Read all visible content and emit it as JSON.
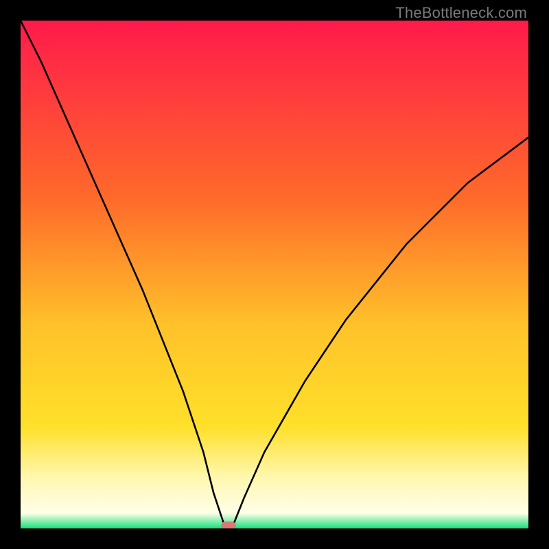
{
  "watermark": "TheBottleneck.com",
  "colors": {
    "red_top": "#ff1a4b",
    "orange": "#ff8a2a",
    "yellow": "#ffe02a",
    "pale_yellow": "#fff7b0",
    "green": "#17e07d",
    "black": "#000000",
    "marker": "#d87a77"
  },
  "chart_data": {
    "type": "line",
    "title": "",
    "xlabel": "",
    "ylabel": "",
    "xlim": [
      0,
      100
    ],
    "ylim": [
      0,
      100
    ],
    "x": [
      0,
      4,
      8,
      12,
      16,
      20,
      24,
      28,
      32,
      36,
      38,
      40,
      41,
      42,
      44,
      48,
      52,
      56,
      60,
      64,
      68,
      72,
      76,
      80,
      84,
      88,
      92,
      96,
      100
    ],
    "values": [
      100,
      92,
      83,
      74,
      65,
      56,
      47,
      37,
      27,
      15,
      7,
      1,
      0,
      1,
      6,
      15,
      22,
      29,
      35,
      41,
      46,
      51,
      56,
      60,
      64,
      68,
      71,
      74,
      77
    ],
    "min_point": {
      "x": 41,
      "y": 0
    },
    "gradient_stops_pct": [
      {
        "offset": 0,
        "color": "#ff1a4b"
      },
      {
        "offset": 35,
        "color": "#ff6a2a"
      },
      {
        "offset": 60,
        "color": "#ffc22a"
      },
      {
        "offset": 80,
        "color": "#ffe02a"
      },
      {
        "offset": 90,
        "color": "#fff7b0"
      },
      {
        "offset": 97,
        "color": "#ffffe8"
      },
      {
        "offset": 100,
        "color": "#17e07d"
      }
    ]
  }
}
